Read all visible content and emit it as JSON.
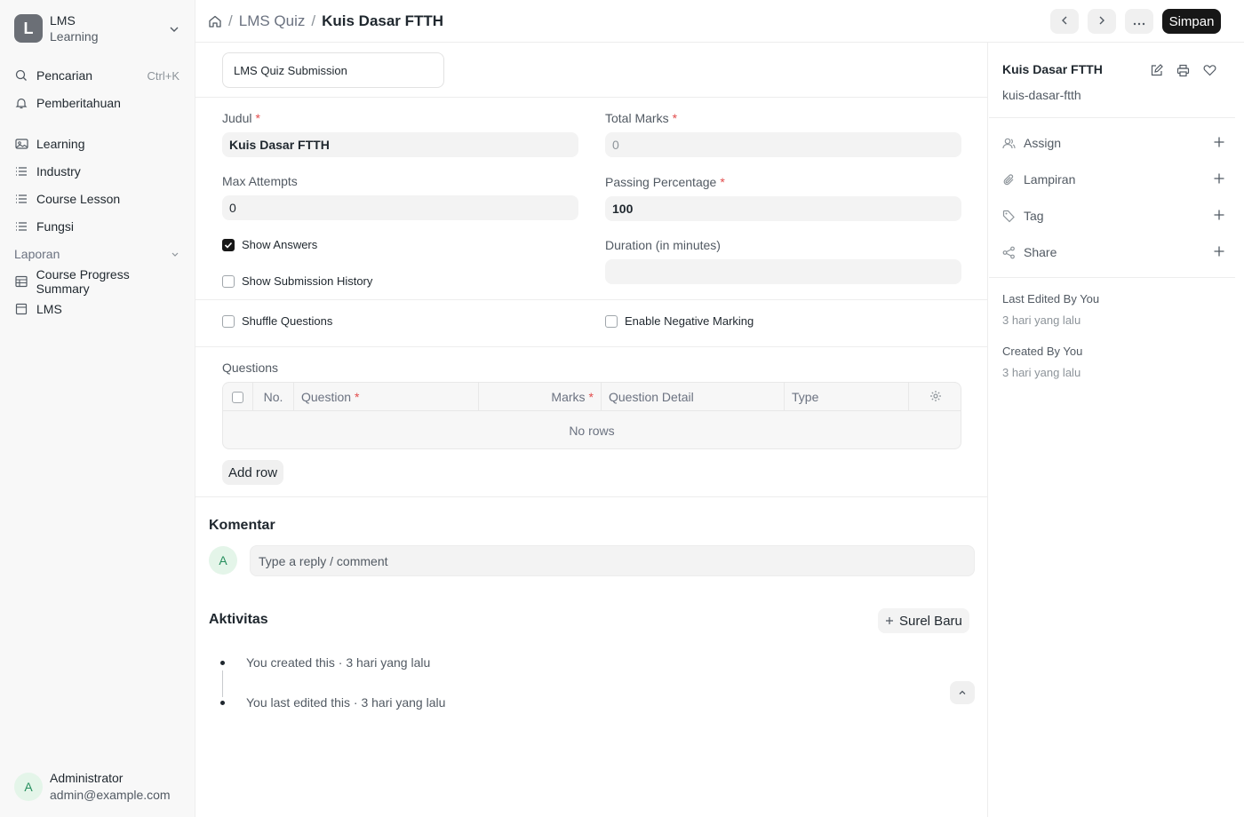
{
  "app": {
    "name": "LMS",
    "subtitle": "Learning",
    "logo_letter": "L"
  },
  "sidebar": {
    "search": {
      "label": "Pencarian",
      "shortcut": "Ctrl+K"
    },
    "notifications": {
      "label": "Pemberitahuan"
    },
    "items": [
      {
        "label": "Learning",
        "icon": "image-icon"
      },
      {
        "label": "Industry",
        "icon": "list-icon"
      },
      {
        "label": "Course Lesson",
        "icon": "list-icon"
      },
      {
        "label": "Fungsi",
        "icon": "list-icon"
      }
    ],
    "reports_section": "Laporan",
    "report_items": [
      {
        "label": "Course Progress Summary",
        "icon": "table-icon"
      },
      {
        "label": "LMS",
        "icon": "calendar-icon"
      }
    ],
    "user": {
      "initial": "A",
      "name": "Administrator",
      "email": "admin@example.com"
    }
  },
  "header": {
    "breadcrumb": [
      "LMS Quiz",
      "Kuis Dasar FTTH"
    ],
    "save_label": "Simpan"
  },
  "form": {
    "tab_label": "LMS Quiz Submission",
    "fields": {
      "judul": {
        "label": "Judul",
        "value": "Kuis Dasar FTTH"
      },
      "total_marks": {
        "label": "Total Marks",
        "value": "0"
      },
      "max_attempts": {
        "label": "Max Attempts",
        "value": "0"
      },
      "passing_percentage": {
        "label": "Passing Percentage",
        "value": "100"
      },
      "duration": {
        "label": "Duration (in minutes)",
        "value": ""
      }
    },
    "checkboxes": {
      "show_answers": {
        "label": "Show Answers",
        "checked": true
      },
      "show_submission_history": {
        "label": "Show Submission History",
        "checked": false
      },
      "shuffle_questions": {
        "label": "Shuffle Questions",
        "checked": false
      },
      "enable_negative_marking": {
        "label": "Enable Negative Marking",
        "checked": false
      }
    },
    "questions": {
      "label": "Questions",
      "columns": {
        "no": "No.",
        "question": "Question",
        "marks": "Marks",
        "detail": "Question Detail",
        "type": "Type"
      },
      "empty_text": "No rows",
      "add_row": "Add row"
    }
  },
  "comments": {
    "title": "Komentar",
    "avatar": "A",
    "placeholder": "Type a reply / comment"
  },
  "activity": {
    "title": "Aktivitas",
    "new_email": "Surel Baru",
    "items": [
      "You created this · 3 hari yang lalu",
      "You last edited this · 3 hari yang lalu"
    ]
  },
  "right_panel": {
    "title": "Kuis Dasar FTTH",
    "name": "kuis-dasar-ftth",
    "actions": [
      "Assign",
      "Lampiran",
      "Tag",
      "Share"
    ],
    "last_edited_label": "Last Edited By You",
    "last_edited_value": "3 hari yang lalu",
    "created_label": "Created By You",
    "created_value": "3 hari yang lalu"
  },
  "colors": {
    "accent": "#171717",
    "required": "#e24c4c",
    "avatar_bg": "#e4f5e9",
    "avatar_fg": "#278f5e"
  }
}
